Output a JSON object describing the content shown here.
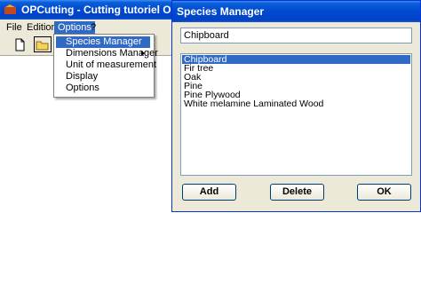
{
  "main_window": {
    "title": "OPCutting - Cutting tutoriel OPCutt",
    "menu": [
      "File",
      "Edition",
      "Options",
      "?"
    ]
  },
  "options_menu": {
    "items": [
      "Species Manager",
      "Dimensions Manager",
      "Unit of measurement",
      "Display",
      "Options"
    ]
  },
  "dialog": {
    "title": "Species Manager",
    "name_value": "Chipboard",
    "species": [
      "Chipboard",
      "Fir tree",
      "Oak",
      "Pine",
      "Pine Plywood",
      "White melamine Laminated Wood"
    ],
    "add_label": "Add",
    "delete_label": "Delete",
    "ok_label": "OK"
  },
  "colors": {
    "titlebar": "#0049d1",
    "selection": "#316ac5",
    "dialog_bg": "#ece9d8"
  }
}
